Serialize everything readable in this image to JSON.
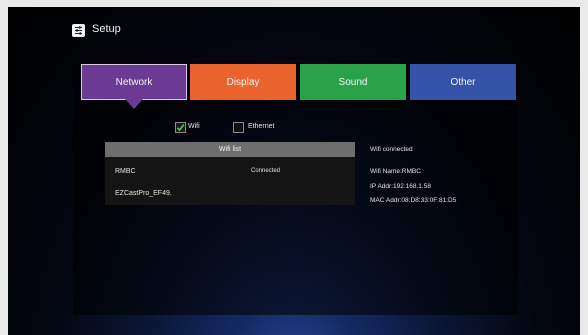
{
  "header": {
    "title": "Setup",
    "icon": "settings-sliders-icon"
  },
  "tabs": [
    {
      "label": "Network",
      "color": "#6b3a93",
      "selected": true
    },
    {
      "label": "Display",
      "color": "#e8642c",
      "selected": false
    },
    {
      "label": "Sound",
      "color": "#2aa24a",
      "selected": false
    },
    {
      "label": "Other",
      "color": "#3452a8",
      "selected": false
    }
  ],
  "network": {
    "wifi": {
      "label": "Wifi",
      "checked": true
    },
    "ethernet": {
      "label": "Ethernet",
      "checked": false
    },
    "wifi_list": {
      "header": "Wifi list",
      "items": [
        {
          "ssid": "RMBC",
          "status": "Connected"
        },
        {
          "ssid": "EZCastPro_EF49.",
          "status": ""
        }
      ]
    },
    "info": {
      "status": "Wifi connected",
      "name": "Wifi Name:RMBC",
      "ip": "IP Addr:192.168.1.58",
      "mac": "MAC Addr:08:D8:33:0F:81:D5"
    }
  }
}
